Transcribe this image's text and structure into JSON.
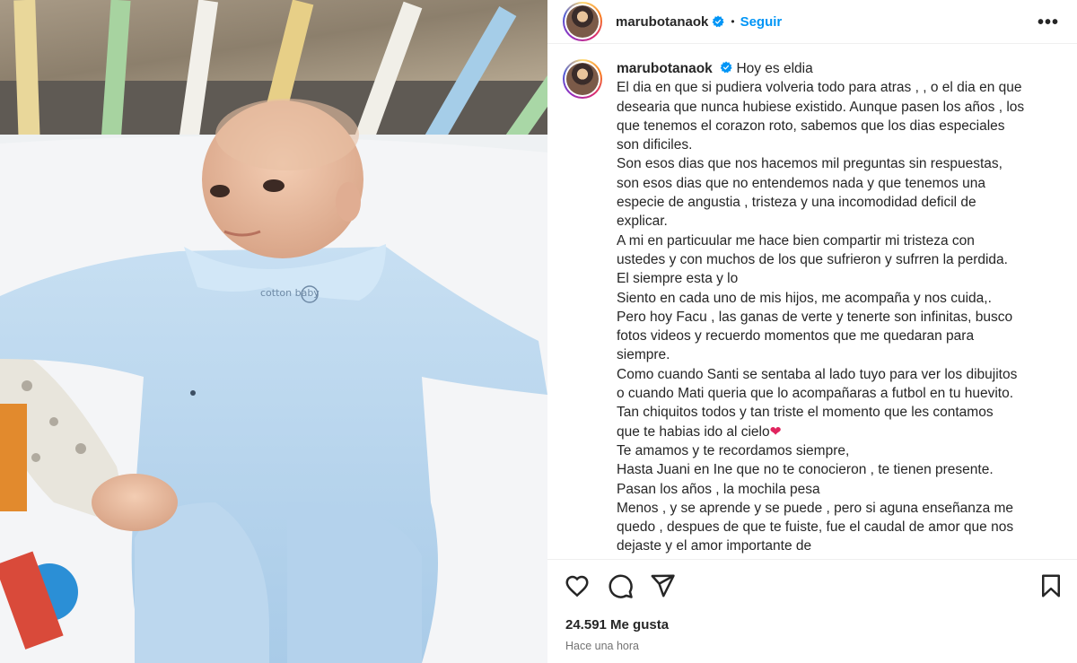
{
  "post": {
    "username": "marubotanaok",
    "separator": "•",
    "follow_label": "Seguir",
    "more_label": "•••",
    "caption_first": "Hoy es eldia",
    "caption_lines": [
      "El dia en que si pudiera volveria todo para atras , , o el dia en que",
      "desearia que nunca hubiese existido. Aunque pasen los años , los",
      "que tenemos el corazon roto, sabemos que los dias especiales",
      "son dificiles.",
      "Son esos dias que nos hacemos mil preguntas sin respuestas,",
      "son esos dias que no entendemos nada y que tenemos una",
      "especie de angustia , tristeza y una incomodidad deficil de",
      "explicar.",
      "A mi en particuular me hace bien compartir mi tristeza con",
      "ustedes y con muchos de los que sufrieron y sufrren la perdida.",
      "El siempre esta y lo",
      "Siento en cada uno de mis hijos, me acompaña y nos cuida,.",
      "Pero hoy Facu , las ganas de verte y tenerte son infinitas, busco",
      "fotos videos y recuerdo momentos que me quedaran para",
      "siempre.",
      "Como cuando Santi se sentaba al lado tuyo para ver los dibujitos",
      "o cuando Mati queria que lo acompañaras a futbol en tu huevito.",
      "Tan chiquitos todos y tan triste el momento que les contamos",
      "que te habias ido al cielo",
      "Te amamos y te recordamos siempre,",
      "Hasta Juani en Ine que no te conocieron , te tienen presente.",
      "Pasan los años , la mochila pesa",
      "Menos , y se aprende y se puede , pero si aguna enseñanza me",
      "quedo , despues de que te fuiste, fue el caudal de amor que nos",
      "dejaste y el amor importante de"
    ],
    "heart_emoji": "❤",
    "likes": "24.591 Me gusta",
    "time": "Hace una hora"
  },
  "icons": {
    "verified": "verified-badge-icon",
    "like": "heart-outline-icon",
    "comment": "comment-bubble-icon",
    "share": "paper-plane-icon",
    "save": "bookmark-icon",
    "more": "more-options-icon"
  },
  "colors": {
    "accent": "#0095f6",
    "text": "#262626",
    "muted": "#737373",
    "divider": "#efefef"
  },
  "photo": {
    "logo_text": "cotton baby"
  }
}
